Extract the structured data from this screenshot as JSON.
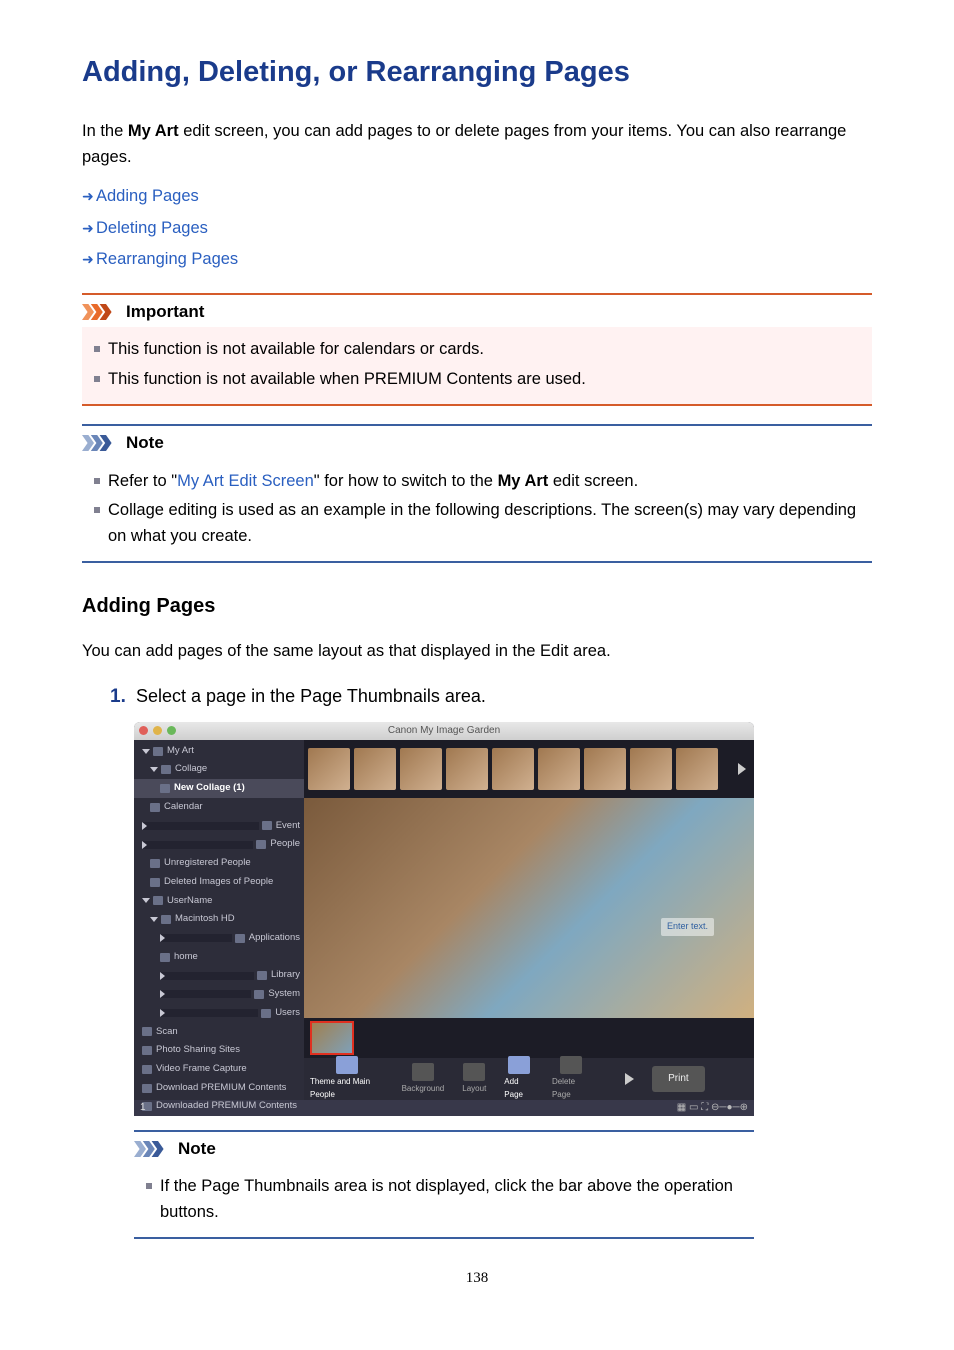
{
  "heading": "Adding, Deleting, or Rearranging Pages",
  "intro_pre": "In the ",
  "intro_bold": "My Art",
  "intro_post": " edit screen, you can add pages to or delete pages from your items. You can also rearrange pages.",
  "nav": {
    "adding": "Adding Pages",
    "deleting": "Deleting Pages",
    "rearranging": "Rearranging Pages"
  },
  "important": {
    "title": "Important",
    "items": [
      "This function is not available for calendars or cards.",
      "This function is not available when PREMIUM Contents are used."
    ]
  },
  "note1": {
    "title": "Note",
    "item1_pre": "Refer to \"",
    "item1_link": "My Art Edit Screen",
    "item1_post": "\" for how to switch to the ",
    "item1_bold": "My Art",
    "item1_end": " edit screen.",
    "item2": "Collage editing is used as an example in the following descriptions. The screen(s) may vary depending on what you create."
  },
  "section_adding": {
    "title": "Adding Pages",
    "intro": "You can add pages of the same layout as that displayed in the Edit area.",
    "step_num": "1.",
    "step_text": "Select a page in the Page Thumbnails area."
  },
  "shot": {
    "window_title": "Canon My Image Garden",
    "enter_text": "Enter text.",
    "print": "Print",
    "status_left": "1",
    "tree": {
      "myart": "My Art",
      "collage": "Collage",
      "new_collage": "New Collage (1)",
      "calendar": "Calendar",
      "event": "Event",
      "people": "People",
      "unreg": "Unregistered People",
      "deleted": "Deleted Images of People",
      "username": "UserName",
      "mac": "Macintosh HD",
      "apps": "Applications",
      "home": "home",
      "library": "Library",
      "system": "System",
      "users": "Users",
      "scan": "Scan",
      "pss": "Photo Sharing Sites",
      "vfc": "Video Frame Capture",
      "dlp": "Download PREMIUM Contents",
      "dlpd": "Downloaded PREMIUM Contents"
    },
    "tools": {
      "theme": "Theme and Main People",
      "bg": "Background",
      "layout": "Layout",
      "add": "Add Page",
      "delete": "Delete Page"
    }
  },
  "note2": {
    "title": "Note",
    "item": "If the Page Thumbnails area is not displayed, click the bar above the operation buttons."
  },
  "page_number": "138"
}
